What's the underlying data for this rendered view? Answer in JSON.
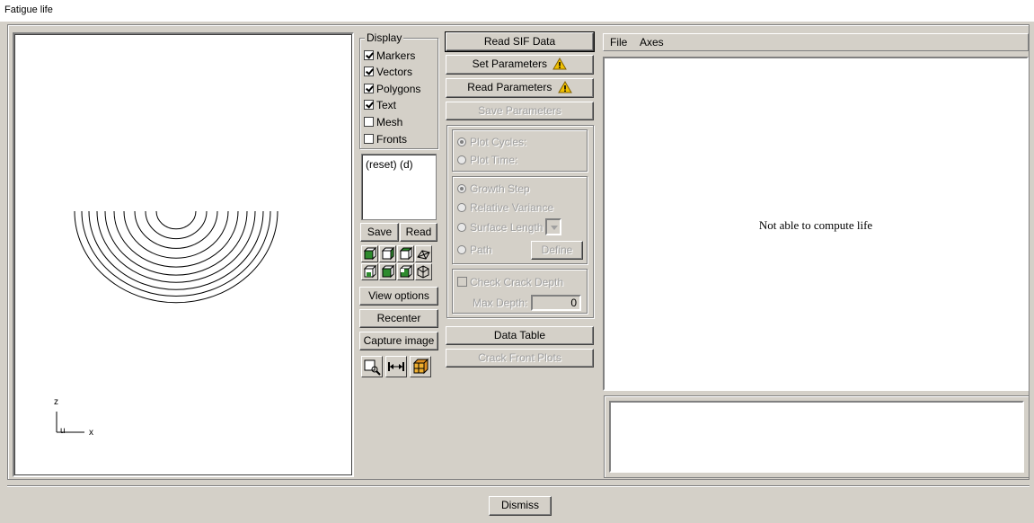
{
  "window": {
    "title": "Fatigue life"
  },
  "viewport": {
    "axis_z": "z",
    "axis_x": "x",
    "axis_u": "u",
    "line_color": "#000000"
  },
  "display_group": {
    "legend": "Display",
    "checkboxes": [
      {
        "label": "Markers",
        "checked": true
      },
      {
        "label": "Vectors",
        "checked": true
      },
      {
        "label": "Polygons",
        "checked": true
      },
      {
        "label": "Text",
        "checked": true
      },
      {
        "label": "Mesh",
        "checked": false
      },
      {
        "label": "Fronts",
        "checked": false
      }
    ],
    "history_list": [
      "(reset) (d)"
    ],
    "save_label": "Save",
    "read_label": "Read",
    "view_icons": [
      "front-view-icon",
      "side-view-icon",
      "back-view-icon",
      "wireframe-icon",
      "bottom-view-icon",
      "top-view-icon",
      "left-view-icon",
      "iso-view-icon"
    ],
    "view_options_label": "View options",
    "recenter_label": "Recenter",
    "capture_label": "Capture image",
    "tool_icons": [
      "zoom-icon",
      "fit-width-icon",
      "render-mode-icon"
    ]
  },
  "actions": {
    "read_sif": "Read SIF Data",
    "set_params": "Set Parameters",
    "read_params": "Read Parameters",
    "save_params": "Save Parameters",
    "plot_cycles": "Plot Cycles:",
    "plot_time": "Plot Time:",
    "growth_step": "Growth Step",
    "relative_variance": "Relative Variance",
    "surface_length": "Surface Length",
    "path": "Path",
    "define": "Define",
    "check_crack_depth": "Check Crack Depth",
    "max_depth_label": "Max Depth:",
    "max_depth_value": "0",
    "data_table": "Data Table",
    "crack_front_plots": "Crack Front Plots",
    "warning_color": "#f0c000"
  },
  "plot_panel": {
    "menu": [
      "File",
      "Axes"
    ],
    "message": "Not able to compute life"
  },
  "footer": {
    "dismiss": "Dismiss"
  }
}
